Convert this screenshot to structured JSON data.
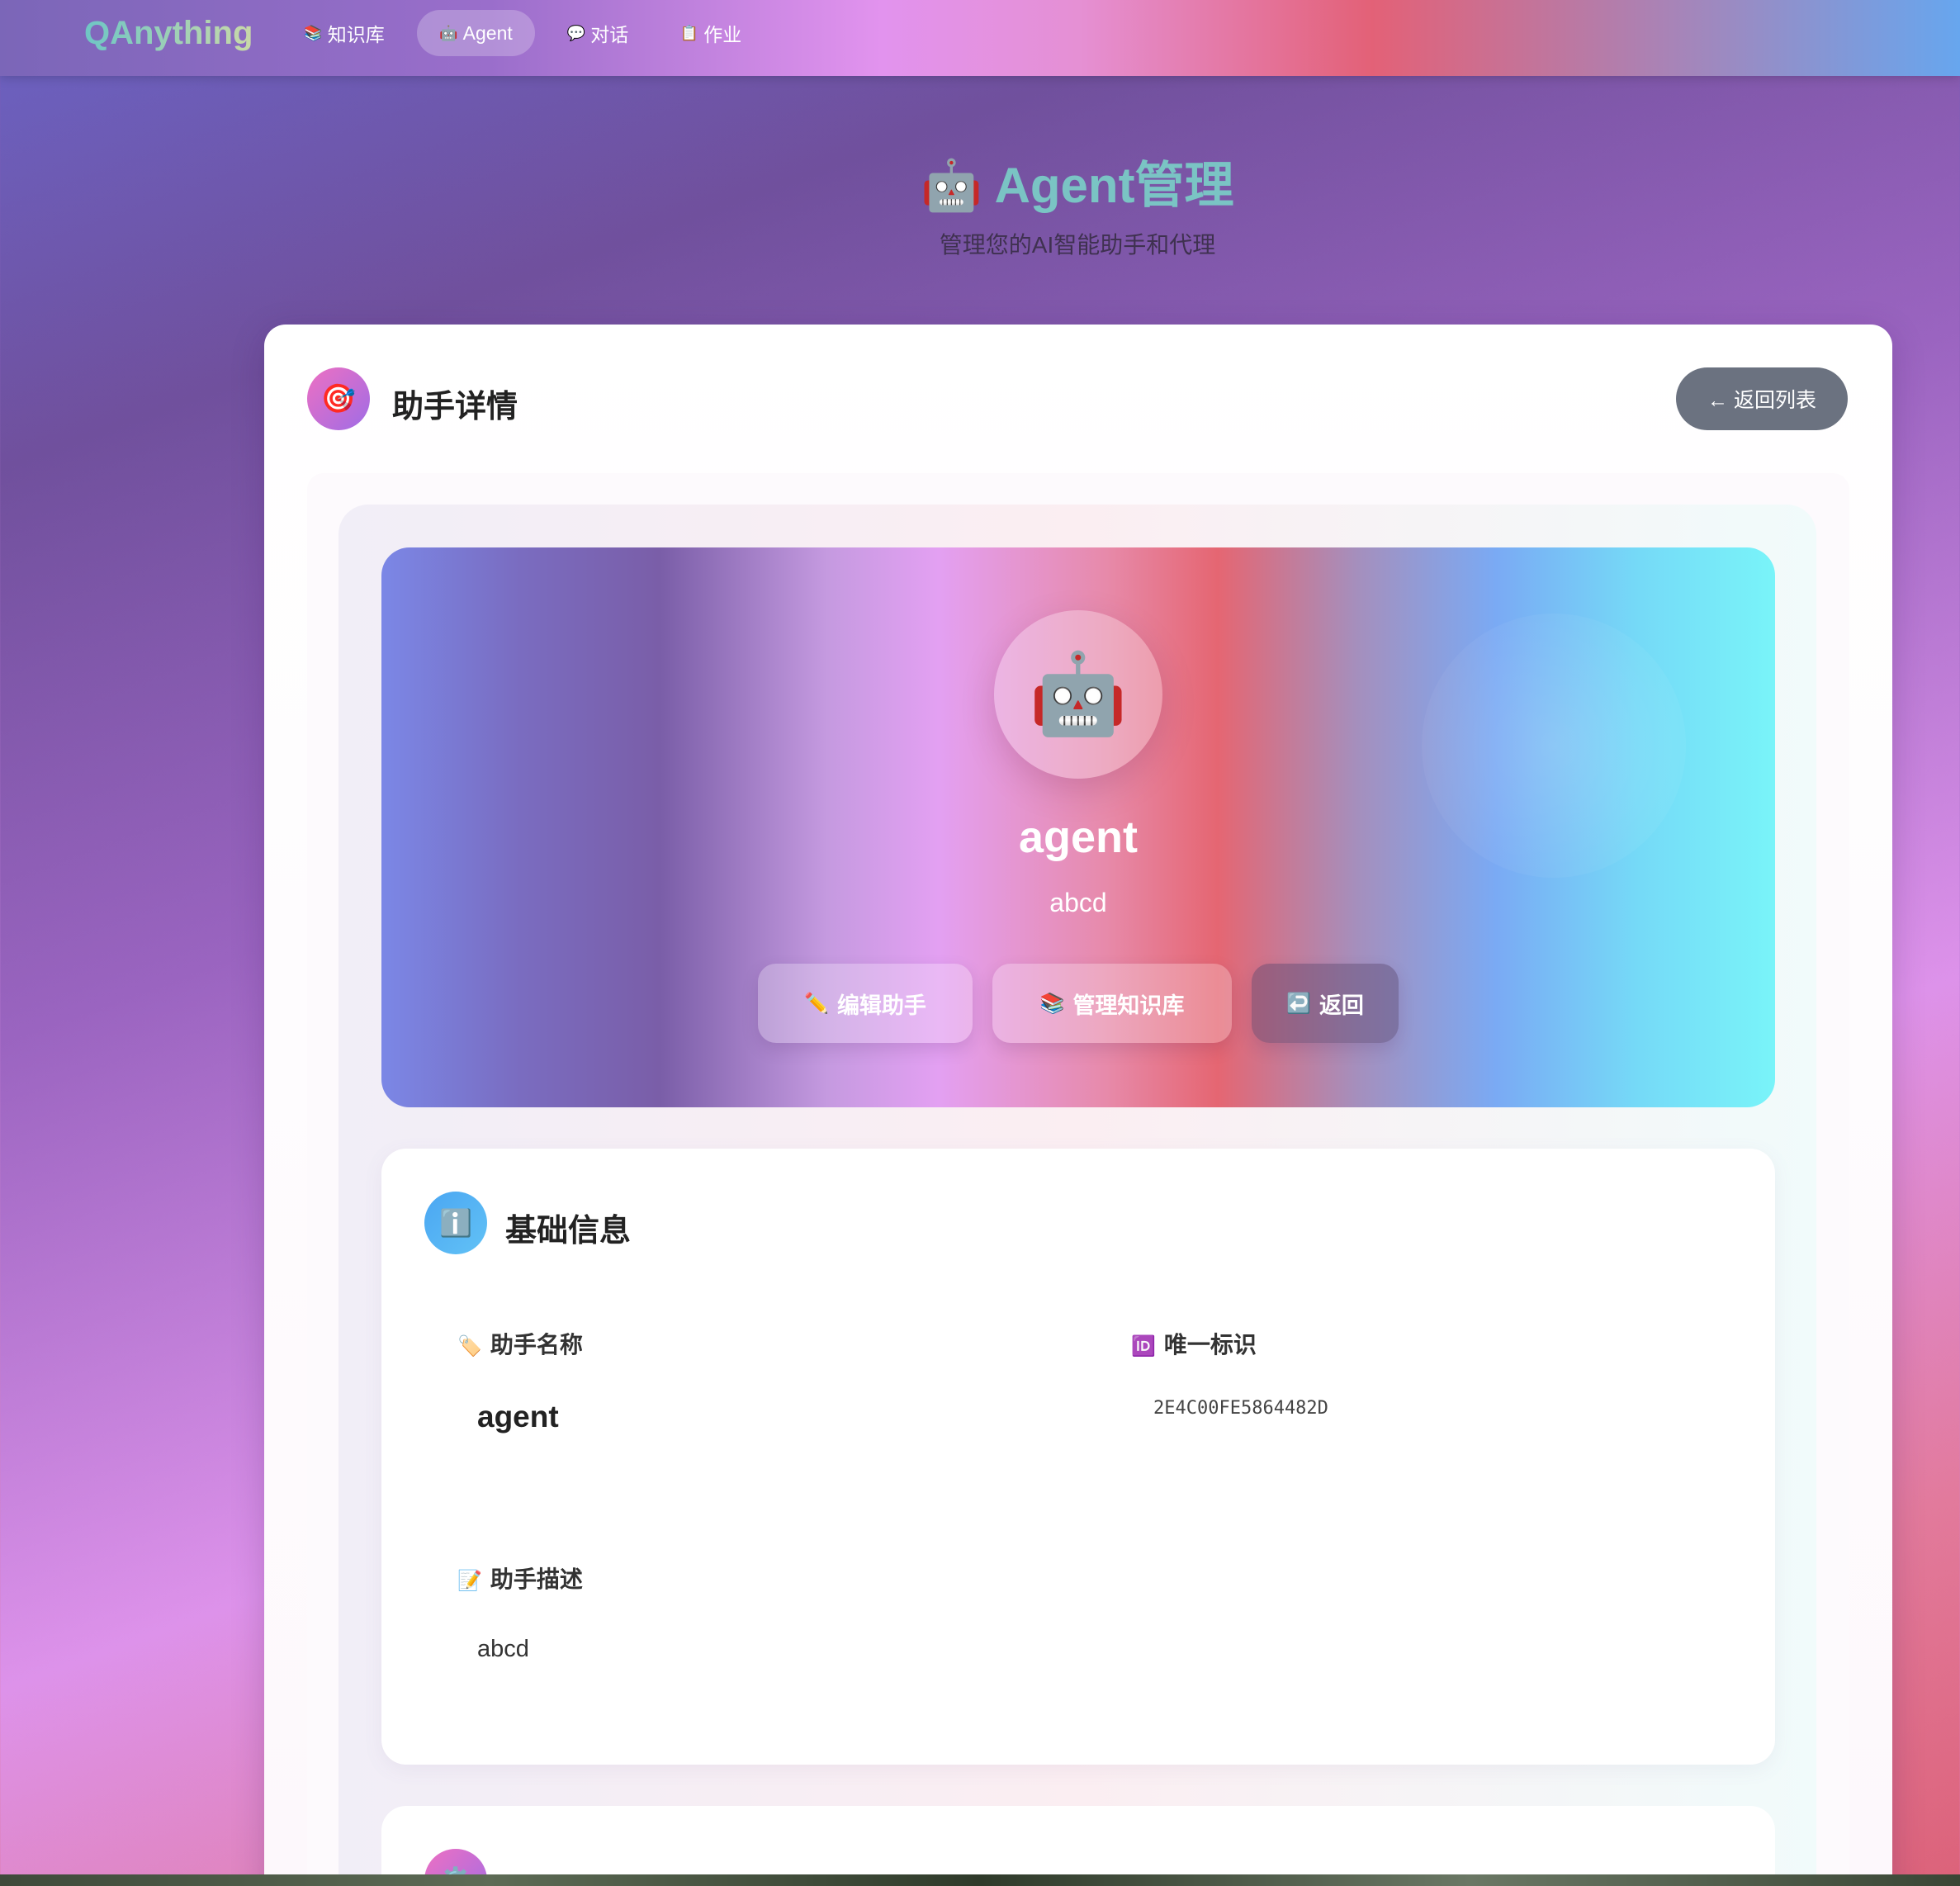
{
  "nav": {
    "brand": "QAnything",
    "items": [
      {
        "icon": "📚",
        "label": "知识库"
      },
      {
        "icon": "🤖",
        "label": "Agent"
      },
      {
        "icon": "💬",
        "label": "对话"
      },
      {
        "icon": "📋",
        "label": "作业"
      }
    ]
  },
  "page": {
    "title": "🤖 Agent管理",
    "subtitle": "管理您的AI智能助手和代理"
  },
  "card": {
    "icon": "🎯",
    "title": "助手详情",
    "back_list_label": "← 返回列表"
  },
  "hero": {
    "avatar": "🤖",
    "name": "agent",
    "desc": "abcd",
    "buttons": [
      {
        "icon": "✏️",
        "label": "编辑助手"
      },
      {
        "icon": "📚",
        "label": "管理知识库"
      },
      {
        "icon": "↩️",
        "label": "返回"
      }
    ]
  },
  "basic": {
    "icon": "ℹ️",
    "title": "基础信息",
    "name_label_icon": "🏷️",
    "name_label": "助手名称",
    "name_value": "agent",
    "id_label_icon": "🆔",
    "id_label": "唯一标识",
    "id_value": "2E4C00FE5864482D",
    "desc_label_icon": "📝",
    "desc_label": "助手描述",
    "desc_value": "abcd"
  },
  "model": {
    "icon": "⚙️"
  },
  "colors": {
    "accent_teal": "#7ac4c4",
    "back_button_gray": "#6b7280",
    "info_blue": "#4aa6f2"
  }
}
